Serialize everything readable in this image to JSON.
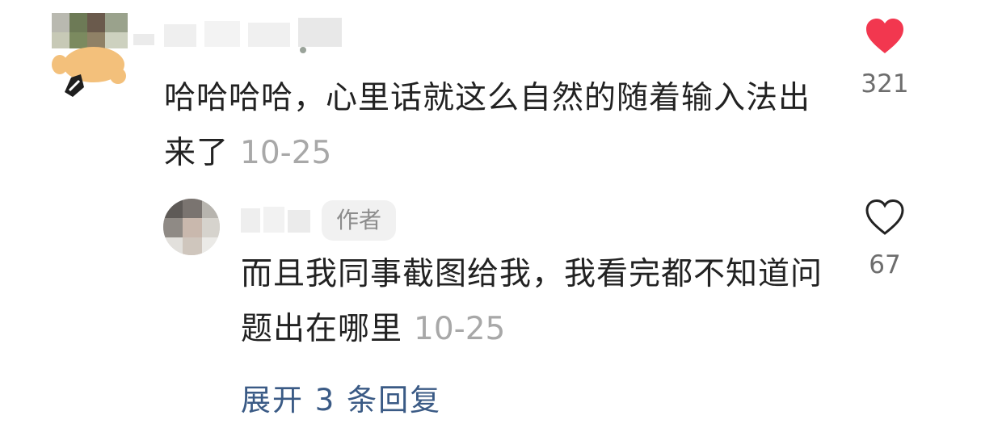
{
  "comment": {
    "text": "哈哈哈哈，心里话就这么自然的随着输入法出来了",
    "date": "10-25",
    "likes": "321",
    "liked": true,
    "like_color": "#f2374f"
  },
  "reply": {
    "badge": "作者",
    "text": "而且我同事截图给我，我看完都不知道问题出在哪里",
    "date": "10-25",
    "likes": "67",
    "liked": false
  },
  "expand": {
    "label": "展开 3 条回复"
  },
  "colors": {
    "text": "#222222",
    "muted": "#a8a8a8",
    "link": "#3a5a85"
  },
  "icons": {
    "liked": "heart-filled-icon",
    "unliked": "heart-outline-icon"
  }
}
